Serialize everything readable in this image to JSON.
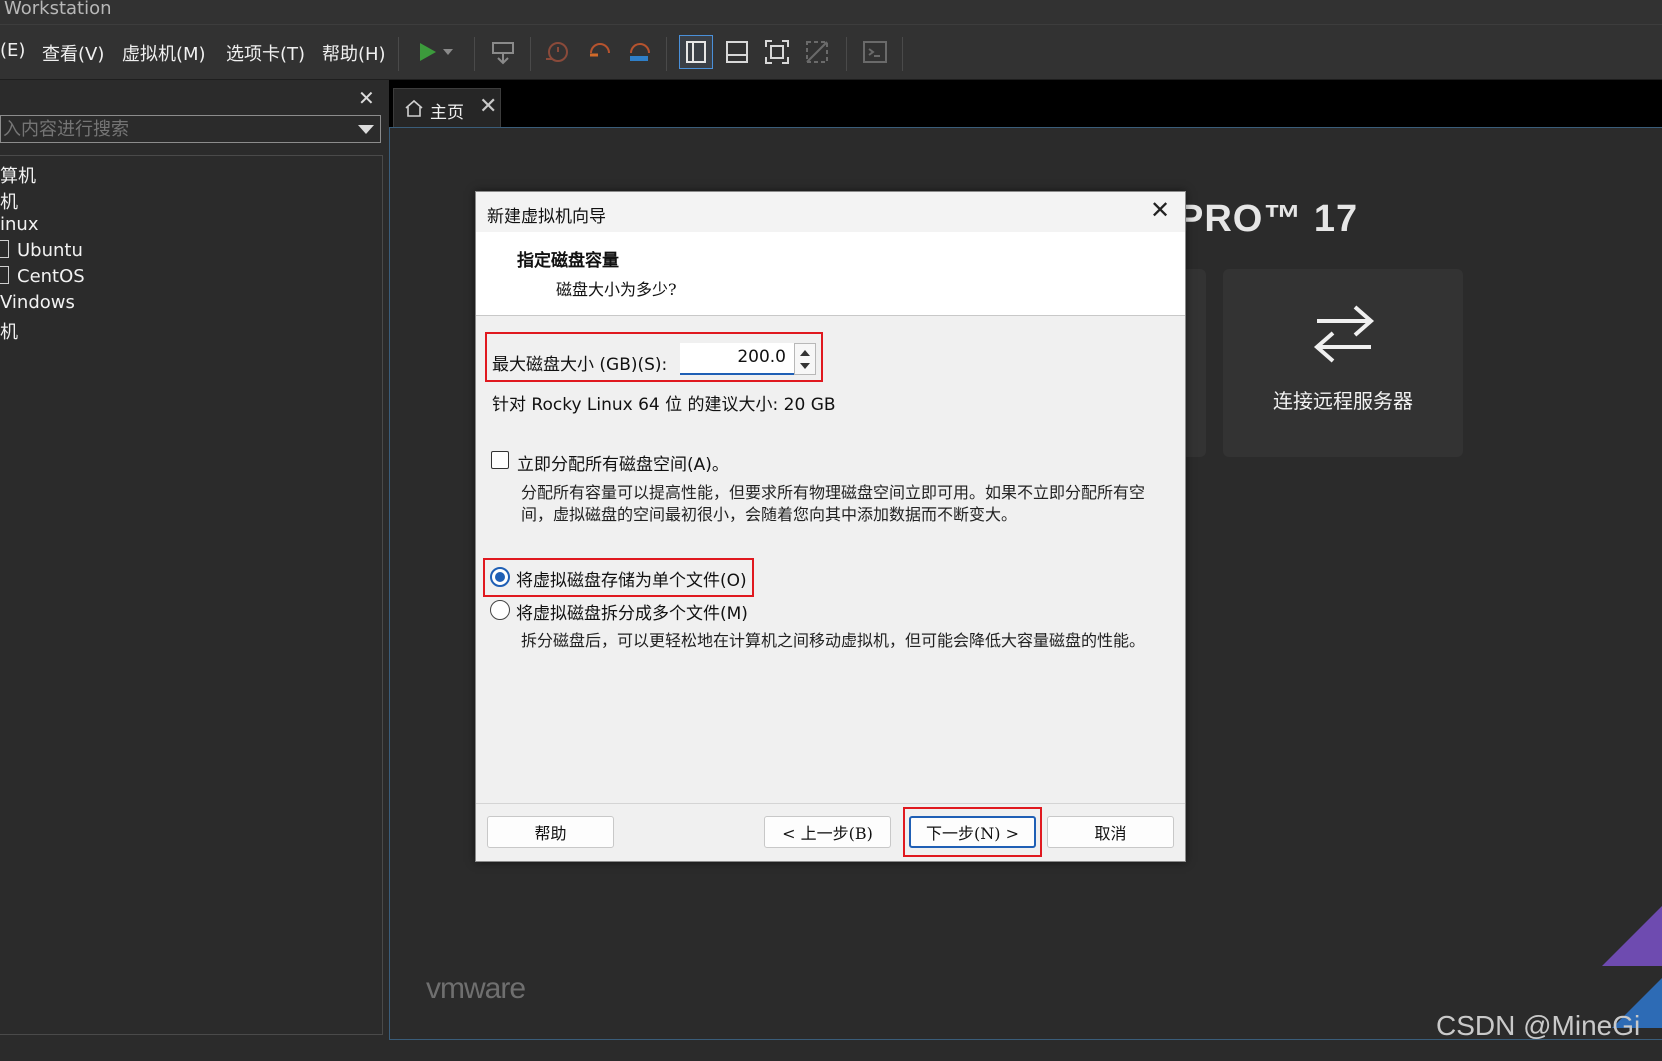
{
  "window": {
    "title": "Workstation"
  },
  "menu": [
    "(E)",
    "查看(V)",
    "虚拟机(M)",
    "选项卡(T)",
    "帮助(H)"
  ],
  "library": {
    "close": "✕",
    "search_placeholder": "入内容进行搜索",
    "tree": [
      "算机",
      "机",
      "inux",
      "Ubuntu",
      "CentOS",
      "Vindows",
      "机"
    ]
  },
  "tabs": [
    {
      "label": "主页",
      "close": "✕"
    }
  ],
  "home": {
    "product_title": "PRO™ 17",
    "connect_label": "连接远程服务器",
    "brand": "vmware"
  },
  "dialog": {
    "title": "新建虚拟机向导",
    "close": "✕",
    "heading": "指定磁盘容量",
    "subheading": "磁盘大小为多少?",
    "size_label": "最大磁盘大小 (GB)(S):",
    "size_value": "200.0",
    "recommend": "针对 Rocky Linux 64 位 的建议大小: 20 GB",
    "allocate_label": "立即分配所有磁盘空间(A)。",
    "allocate_checked": false,
    "allocate_desc": "分配所有容量可以提高性能，但要求所有物理磁盘空间立即可用。如果不立即分配所有空间，虚拟磁盘的空间最初很小，会随着您向其中添加数据而不断变大。",
    "single_file_label": "将虚拟磁盘存储为单个文件(O)",
    "multi_file_label": "将虚拟磁盘拆分成多个文件(M)",
    "selected_option": "single_file",
    "split_desc": "拆分磁盘后，可以更轻松地在计算机之间移动虚拟机，但可能会降低大容量磁盘的性能。",
    "buttons": {
      "help": "帮助",
      "back": "< 上一步(B)",
      "next": "下一步(N) >",
      "cancel": "取消"
    }
  },
  "watermark": "CSDN @MineGi",
  "colors": {
    "accent": "#1f5fb5",
    "highlight": "#e0191f",
    "play": "#3c9b3c"
  }
}
